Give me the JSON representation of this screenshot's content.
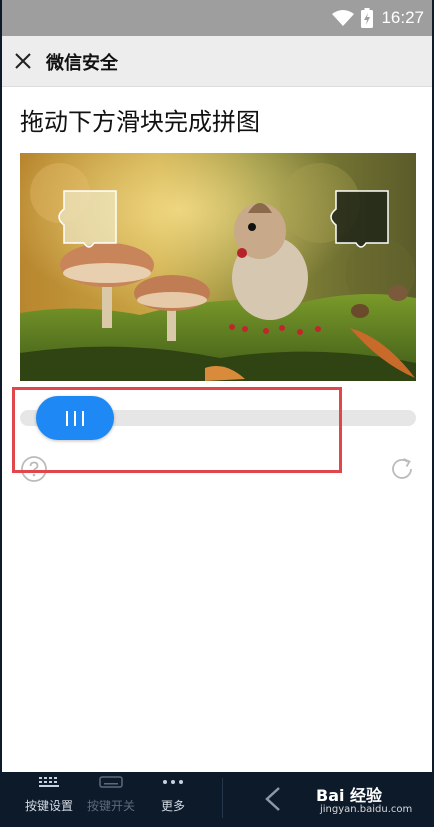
{
  "status_bar": {
    "time": "16:27"
  },
  "header": {
    "title": "微信安全"
  },
  "captcha": {
    "instruction": "拖动下方滑块完成拼图",
    "slider_position_fraction": 0.05
  },
  "navbar": {
    "items": [
      {
        "label": "按键设置",
        "icon": "keypad-icon"
      },
      {
        "label": "按键开关",
        "icon": "keyboard-toggle-icon"
      },
      {
        "label": "更多",
        "icon": "more-dots-icon"
      }
    ]
  },
  "watermark": {
    "brand": "Bai 经验",
    "url": "jingyan.baidu.com"
  },
  "colors": {
    "slider_accent": "#1e88f5",
    "highlight_border": "#e0474c",
    "status_bar": "#9e9e9e",
    "navbar_bg": "#0d1a2a"
  }
}
